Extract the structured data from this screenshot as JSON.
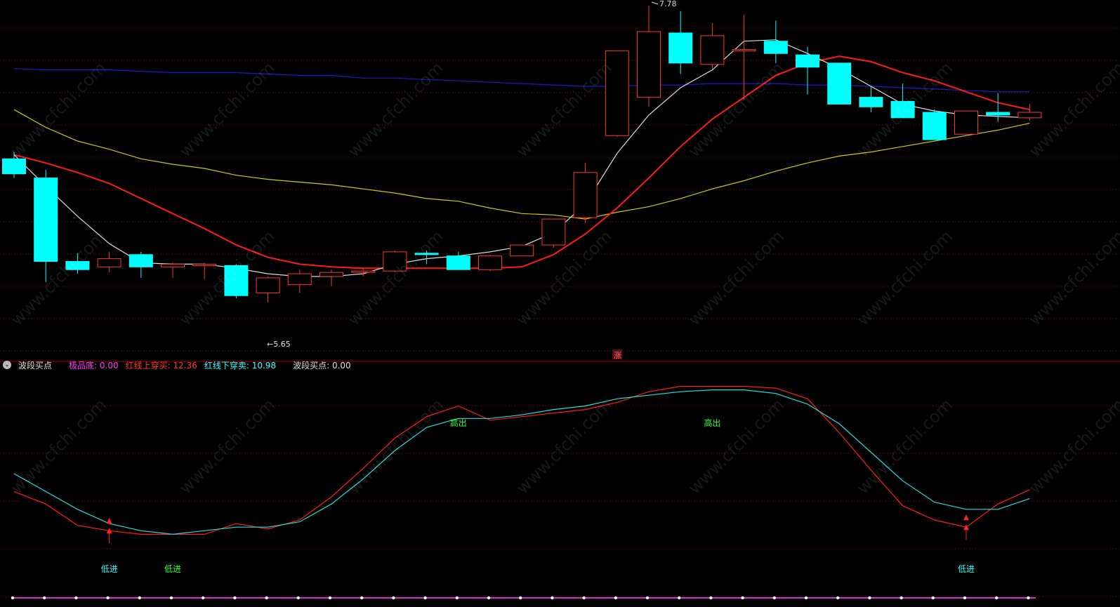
{
  "price_panel": {
    "high_label": "7.78",
    "low_label": "←5.65",
    "zhang_badge": "涨"
  },
  "indicator": {
    "name": "波段买点",
    "items": [
      {
        "label": "极品底:",
        "value": "0.00",
        "color": "#ff33ff"
      },
      {
        "label": "红线上穿买:",
        "value": "12.36",
        "color": "#ff3333"
      },
      {
        "label": "红线下穿卖:",
        "value": "10.98",
        "color": "#33ffff"
      },
      {
        "label": "波段买点:",
        "value": "0.00",
        "color": "#dddddd"
      }
    ],
    "signals": [
      {
        "text": "低进",
        "index": 3,
        "color": "#33ffff"
      },
      {
        "text": "低进",
        "index": 5,
        "color": "#33ff33"
      },
      {
        "text": "高出",
        "index": 14,
        "color": "#33ff33"
      },
      {
        "text": "高出",
        "index": 22,
        "color": "#33ff33"
      },
      {
        "text": "低进",
        "index": 30,
        "color": "#33ffff"
      }
    ]
  },
  "watermark": "www.cfchi.com",
  "colors": {
    "up": "#ff3333",
    "down": "#00ffff",
    "ma_white": "#dddddd",
    "ma_red": "#ff1a1a",
    "ma_yellow": "#cccc00",
    "ma_blue": "#1a1acc",
    "grid": "#8b0000",
    "signal_arrow": "#ff2222",
    "time_axis": "#cc33cc"
  },
  "chart_data": [
    {
      "type": "candlestick",
      "ylim": [
        5.45,
        7.82
      ],
      "candles": [
        {
          "open": 6.7,
          "high": 6.75,
          "low": 6.56,
          "close": 6.59
        },
        {
          "open": 6.56,
          "high": 6.62,
          "low": 5.8,
          "close": 5.95
        },
        {
          "open": 5.95,
          "high": 6.01,
          "low": 5.86,
          "close": 5.89
        },
        {
          "open": 5.91,
          "high": 6.02,
          "low": 5.87,
          "close": 5.97
        },
        {
          "open": 6.0,
          "high": 6.02,
          "low": 5.83,
          "close": 5.91
        },
        {
          "open": 5.91,
          "high": 5.94,
          "low": 5.83,
          "close": 5.93
        },
        {
          "open": 5.93,
          "high": 5.94,
          "low": 5.82,
          "close": 5.93
        },
        {
          "open": 5.92,
          "high": 5.93,
          "low": 5.68,
          "close": 5.7
        },
        {
          "open": 5.72,
          "high": 5.84,
          "low": 5.65,
          "close": 5.83
        },
        {
          "open": 5.78,
          "high": 5.89,
          "low": 5.72,
          "close": 5.86
        },
        {
          "open": 5.84,
          "high": 5.89,
          "low": 5.77,
          "close": 5.87
        },
        {
          "open": 5.87,
          "high": 5.9,
          "low": 5.84,
          "close": 5.88
        },
        {
          "open": 5.88,
          "high": 6.03,
          "low": 5.87,
          "close": 6.02
        },
        {
          "open": 6.01,
          "high": 6.03,
          "low": 5.93,
          "close": 6.0
        },
        {
          "open": 5.99,
          "high": 6.02,
          "low": 5.89,
          "close": 5.89
        },
        {
          "open": 5.89,
          "high": 6.0,
          "low": 5.88,
          "close": 5.99
        },
        {
          "open": 5.99,
          "high": 6.07,
          "low": 5.99,
          "close": 6.07
        },
        {
          "open": 6.07,
          "high": 6.26,
          "low": 6.05,
          "close": 6.26
        },
        {
          "open": 6.27,
          "high": 6.67,
          "low": 6.23,
          "close": 6.6
        },
        {
          "open": 6.87,
          "high": 7.41,
          "low": 6.86,
          "close": 7.49
        },
        {
          "open": 7.15,
          "high": 7.82,
          "low": 7.08,
          "close": 7.63
        },
        {
          "open": 7.62,
          "high": 7.78,
          "low": 7.32,
          "close": 7.4
        },
        {
          "open": 7.39,
          "high": 7.69,
          "low": 7.36,
          "close": 7.6
        },
        {
          "open": 7.5,
          "high": 7.75,
          "low": 7.13,
          "close": 7.5
        },
        {
          "open": 7.56,
          "high": 7.71,
          "low": 7.4,
          "close": 7.47
        },
        {
          "open": 7.46,
          "high": 7.52,
          "low": 7.17,
          "close": 7.37
        },
        {
          "open": 7.4,
          "high": 7.4,
          "low": 7.21,
          "close": 7.1
        },
        {
          "open": 7.15,
          "high": 7.23,
          "low": 7.04,
          "close": 7.08
        },
        {
          "open": 7.12,
          "high": 7.25,
          "low": 7.04,
          "close": 7.0
        },
        {
          "open": 7.04,
          "high": 7.06,
          "low": 6.85,
          "close": 6.84
        },
        {
          "open": 6.88,
          "high": 7.05,
          "low": 6.87,
          "close": 7.05
        },
        {
          "open": 7.04,
          "high": 7.18,
          "low": 6.97,
          "close": 7.02
        },
        {
          "open": 7.0,
          "high": 7.1,
          "low": 6.98,
          "close": 7.04
        }
      ],
      "ma_white": [
        6.73,
        6.5,
        6.28,
        6.08,
        5.94,
        5.93,
        5.93,
        5.9,
        5.86,
        5.84,
        5.84,
        5.86,
        5.93,
        5.97,
        5.99,
        6.02,
        6.06,
        6.16,
        6.37,
        6.74,
        7.02,
        7.22,
        7.35,
        7.56,
        7.57,
        7.47,
        7.36,
        7.23,
        7.1,
        7.05,
        7.02,
        7.01,
        7.0
      ],
      "ma_red": [
        6.73,
        6.67,
        6.6,
        6.52,
        6.41,
        6.3,
        6.19,
        6.07,
        5.98,
        5.93,
        5.91,
        5.9,
        5.9,
        5.9,
        5.9,
        5.9,
        5.91,
        6.0,
        6.15,
        6.34,
        6.56,
        6.79,
        6.99,
        7.15,
        7.31,
        7.4,
        7.45,
        7.41,
        7.33,
        7.27,
        7.19,
        7.11,
        7.06
      ],
      "ma_yellow": [
        7.06,
        6.93,
        6.83,
        6.77,
        6.7,
        6.66,
        6.63,
        6.58,
        6.55,
        6.53,
        6.51,
        6.48,
        6.45,
        6.41,
        6.39,
        6.34,
        6.3,
        6.29,
        6.26,
        6.31,
        6.35,
        6.41,
        6.48,
        6.54,
        6.61,
        6.67,
        6.72,
        6.75,
        6.79,
        6.83,
        6.87,
        6.91,
        6.96
      ],
      "ma_blue": [
        7.36,
        7.35,
        7.35,
        7.35,
        7.34,
        7.33,
        7.33,
        7.33,
        7.32,
        7.31,
        7.31,
        7.29,
        7.29,
        7.28,
        7.27,
        7.26,
        7.25,
        7.24,
        7.23,
        7.23,
        7.24,
        7.24,
        7.25,
        7.25,
        7.25,
        7.24,
        7.24,
        7.23,
        7.22,
        7.21,
        7.2,
        7.19,
        7.19
      ]
    },
    {
      "type": "line",
      "ylim": [
        0,
        100
      ],
      "series": [
        {
          "color": "#ff1a1a",
          "values": [
            40,
            33,
            21,
            18,
            16,
            16,
            16,
            22,
            19,
            24,
            37,
            53,
            70,
            82,
            88,
            80,
            82,
            84,
            86,
            90,
            96,
            99,
            99,
            99,
            98,
            92,
            73,
            52,
            32,
            24,
            20,
            33,
            41
          ]
        },
        {
          "color": "#22dddd",
          "values": [
            50,
            40,
            30,
            22,
            18,
            16,
            18,
            20,
            20,
            23,
            33,
            47,
            63,
            76,
            81,
            81,
            83,
            86,
            88,
            92,
            94,
            96,
            97,
            97,
            95,
            89,
            78,
            62,
            46,
            34,
            30,
            30,
            36
          ]
        }
      ]
    }
  ]
}
